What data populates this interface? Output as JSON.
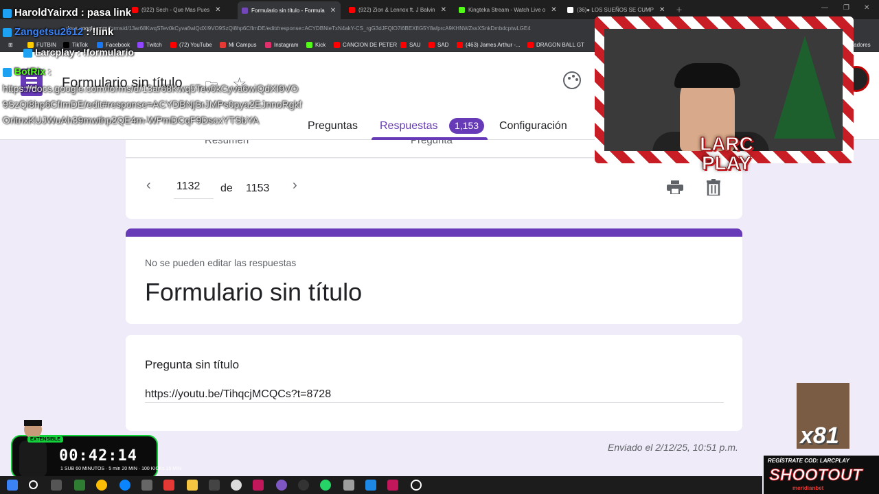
{
  "browser": {
    "tabs": [
      {
        "label": "(922) Sech - Que Mas Pues",
        "color": "#ff0000"
      },
      {
        "label": "Formulario sin título - Formula",
        "color": "#7248b9",
        "active": true
      },
      {
        "label": "(922) Zion & Lennox ft. J Balvin",
        "color": "#ff0000"
      },
      {
        "label": "Kingteka Stream - Watch Live o",
        "color": "#53fc18"
      },
      {
        "label": "(36)● LOS SUEÑOS SE CUMP",
        "color": "#ffffff"
      }
    ],
    "url_host": "docs.google.com",
    "url_path": "/forms/d/13ar68KwqSTev0kCyva6wiQdXI9VO9SzQi8hp6CfImDE/edit#response=ACYDBNieTxN4akY-CS_rgG3dJFQlO7i6BEXfIG5Y8afprcA9KHNWZssXSnkDmbdcptwLGE4",
    "bookmarks": [
      {
        "label": "FUTBIN",
        "color": "#ffcc00"
      },
      {
        "label": "TikTok",
        "color": "#000000"
      },
      {
        "label": "Facebook",
        "color": "#1877f2"
      },
      {
        "label": "Twitch",
        "color": "#9146ff"
      },
      {
        "label": "(72) YouTube",
        "color": "#ff0000"
      },
      {
        "label": "Mi Campus",
        "color": "#e53935"
      },
      {
        "label": "Instagram",
        "color": "#e1306c"
      },
      {
        "label": "Kick",
        "color": "#53fc18"
      },
      {
        "label": "CANCION DE PETER",
        "color": "#ff0000"
      },
      {
        "label": "SAU",
        "color": "#ff0000"
      },
      {
        "label": "SAD",
        "color": "#ff0000"
      },
      {
        "label": "(463) James Arthur -...",
        "color": "#ff0000"
      },
      {
        "label": "DRAGON BALL GT",
        "color": "#ff0000"
      },
      {
        "label": "arcadores",
        "color": "#1a73e8"
      }
    ]
  },
  "form": {
    "title": "Formulario sin título",
    "tabs": {
      "questions": "Preguntas",
      "responses": "Respuestas",
      "settings": "Configuración"
    },
    "response_count": "1,153",
    "subtabs": {
      "summary": "Resumen",
      "question": "Pregunta"
    },
    "nav": {
      "current": "1132",
      "of": "de",
      "total": "1153"
    },
    "cannot_edit": "No se pueden editar las respuestas",
    "question_title": "Pregunta sin título",
    "answer": "https://youtu.be/TihqcjMCQCs?t=8728",
    "sent_at": "Enviado el 2/12/25, 10:51 p.m.",
    "accent": "#673ab7"
  },
  "overlay": {
    "chat": [
      {
        "user": "HaroldYairxd",
        "msg": ": pasa link",
        "color": "#ffffff"
      },
      {
        "user": "Zangetsu2612",
        "msg": ": !link",
        "color": "#3b82f6"
      },
      {
        "user": "Larcplay",
        "msg": ": !formulario",
        "color": "#ffffff"
      },
      {
        "user": "BotRix",
        "msg": ":",
        "color": "#53fc18"
      }
    ],
    "link_text": "https://docs.google.com/forms/d/13ar68Kwq5Tev0kCyva6wiQdXI9VO9SzQi8hp6CfImDE/edit#response=ACYDBNjSrJMPs0pya2EJnnoRgkfOritnxKUJWuAh39mwthp2QE4m-WPmDCqF9DscxYTSbYA",
    "logo_text": "LARC PLAY",
    "timer_tag": "EXTENSIBLE",
    "timer": "00:42:14",
    "timer_subs": "1 SUB 60 MINUTOS · 5 min 20 MIN · 100 KICKs 15 MIN",
    "multiplier": "x81",
    "ad_register": "REGÍSTRATE COD: LARCPLAY",
    "ad_title": "SHOOTOUT",
    "ad_brand": "meridianbet"
  }
}
